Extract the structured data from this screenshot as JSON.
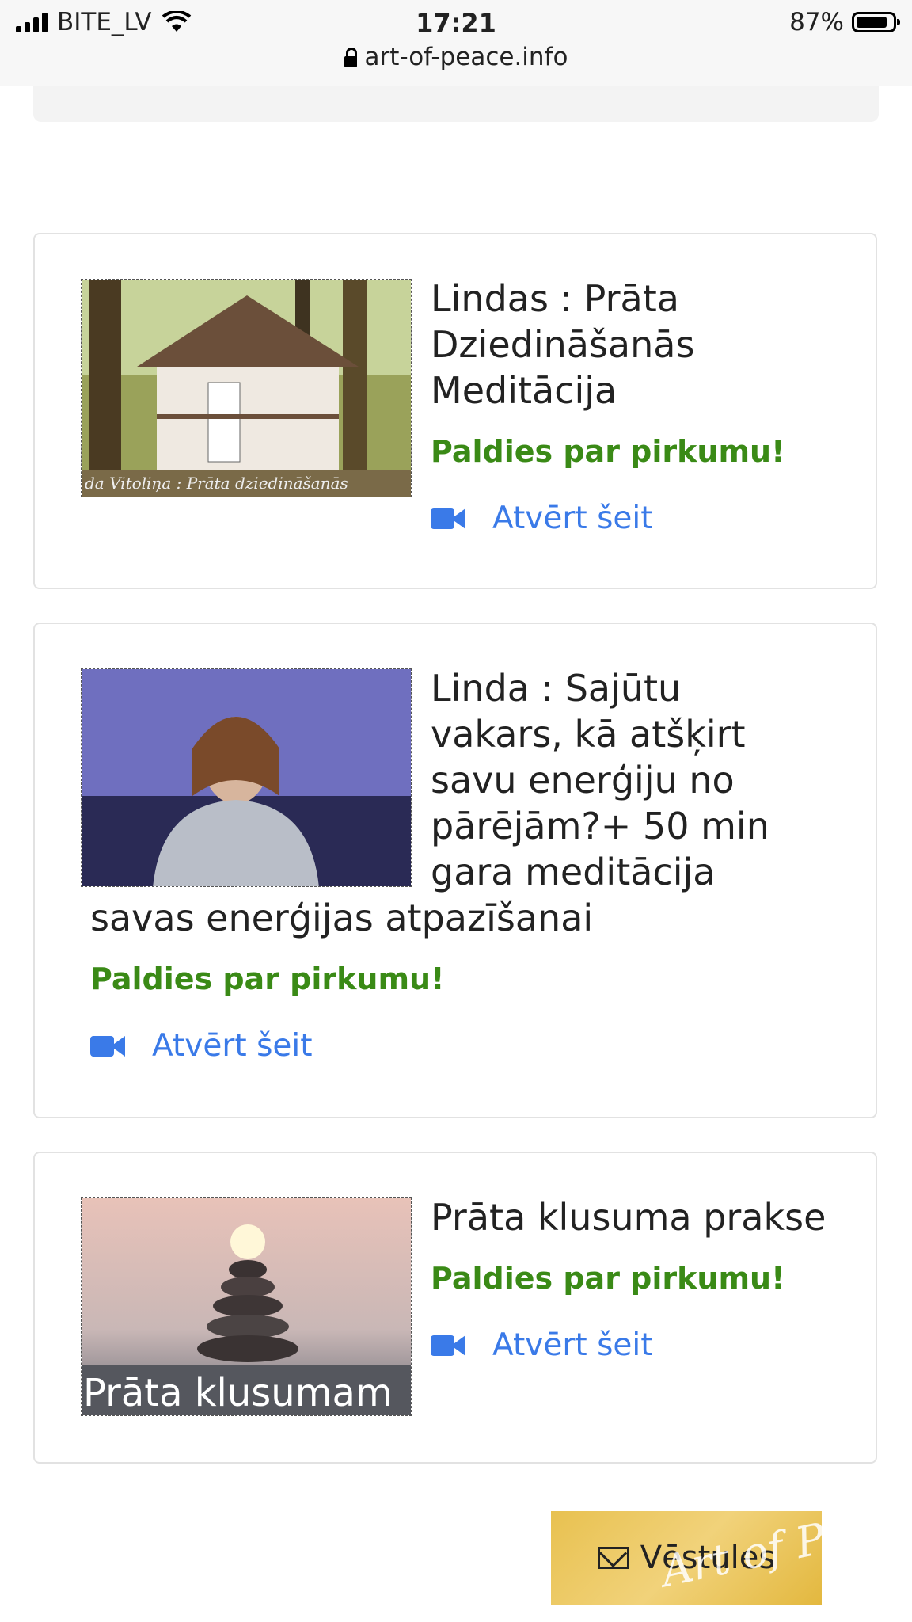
{
  "status": {
    "carrier": "BITE_LV",
    "time": "17:21",
    "battery": "87%",
    "battery_fraction": 0.87,
    "url": "art-of-peace.info"
  },
  "cards": [
    {
      "title": "Lindas : Prāta Dziedināšanās Meditācija",
      "thumb_caption": "da Vitoliņa : Prāta dziedināšanās",
      "thanks": "Paldies par pirkumu!",
      "link": "Atvērt šeit"
    },
    {
      "title_lines": [
        "Linda : Sajūtu",
        "vakars, kā atšķirt",
        "savu enerģiju no",
        "pārējām?+ 50 min",
        "gara meditācija",
        "savas enerģijas atpazīšanai"
      ],
      "thanks": "Paldies par pirkumu!",
      "link": "Atvērt šeit"
    },
    {
      "title": "Prāta klusuma prakse",
      "thumb_caption": "Prāta klusumam",
      "thanks": "Paldies par pirkumu!",
      "link": "Atvērt šeit"
    }
  ],
  "letters_button": {
    "label": "Vēstules",
    "watermark": "Art of P"
  },
  "colors": {
    "green": "#3a8a16",
    "link_blue": "#3a7ae8",
    "gold": "#e8c150"
  }
}
